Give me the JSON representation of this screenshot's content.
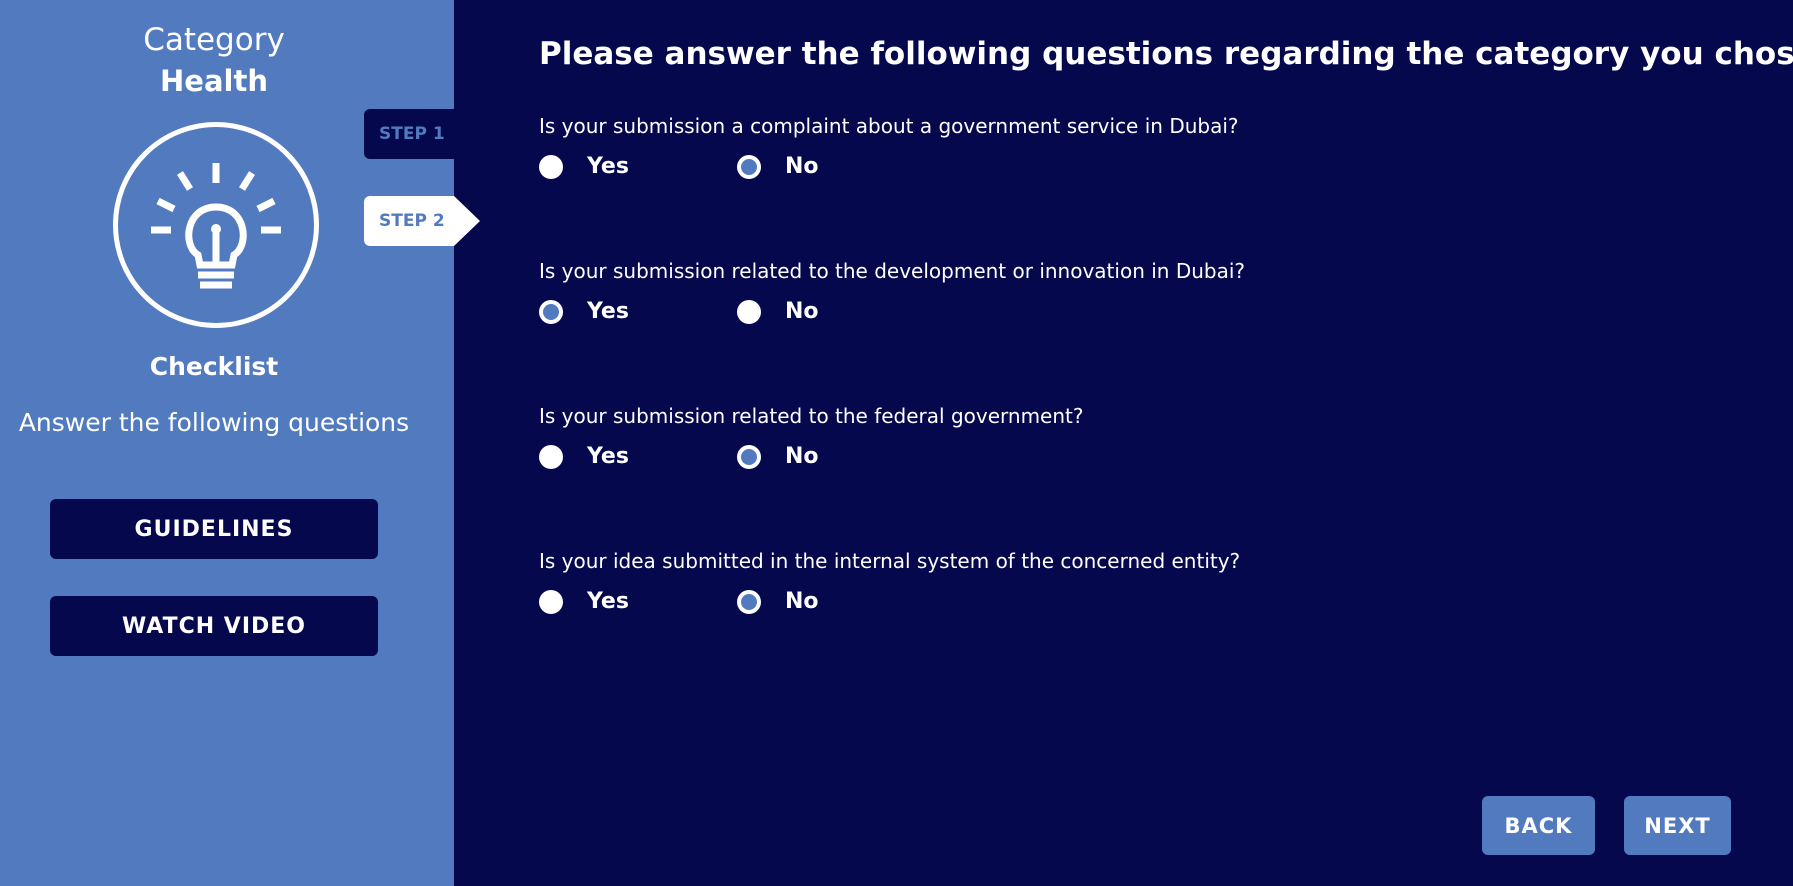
{
  "sidebar": {
    "category_label": "Category",
    "category_value": "Health",
    "icon": "lightbulb-icon",
    "checklist_title": "Checklist",
    "description": "Answer the following questions",
    "guidelines_label": "GUIDELINES",
    "watch_video_label": "WATCH VIDEO"
  },
  "steps": [
    {
      "label": "STEP 1",
      "active": false
    },
    {
      "label": "STEP 2",
      "active": true
    }
  ],
  "main": {
    "title": "Please answer the following questions regarding the category you chose:",
    "questions": [
      {
        "text": "Is your submission a complaint about a government service in Dubai?",
        "yes": "Yes",
        "no": "No",
        "selected": "No"
      },
      {
        "text": "Is your submission related to the development or innovation in Dubai?",
        "yes": "Yes",
        "no": "No",
        "selected": "Yes"
      },
      {
        "text": "Is your submission related to the federal government?",
        "yes": "Yes",
        "no": "No",
        "selected": "No"
      },
      {
        "text": "Is your idea submitted in the internal system of the concerned entity?",
        "yes": "Yes",
        "no": "No",
        "selected": "No"
      }
    ]
  },
  "nav": {
    "back_label": "BACK",
    "next_label": "NEXT"
  },
  "colors": {
    "sidebar_bg": "#527bbf",
    "main_bg": "#06084d",
    "accent": "#527bbf"
  }
}
